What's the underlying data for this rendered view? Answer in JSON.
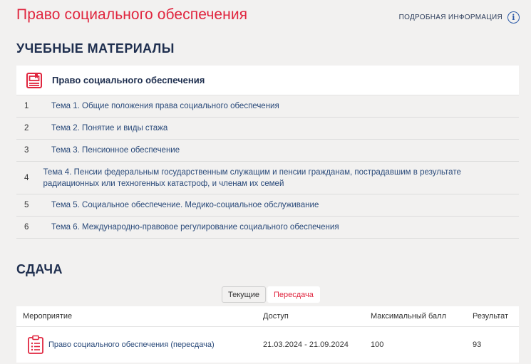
{
  "header": {
    "title": "Право социального обеспечения",
    "more_info": "ПОДРОБНАЯ ИНФОРМАЦИЯ",
    "info_glyph": "i"
  },
  "materials": {
    "section_title": "УЧЕБНЫЕ МАТЕРИАЛЫ",
    "course_name": "Право социального обеспечения",
    "topics": [
      {
        "num": "1",
        "title": "Тема 1. Общие положения права социального обеспечения"
      },
      {
        "num": "2",
        "title": "Тема 2. Понятие и виды стажа"
      },
      {
        "num": "3",
        "title": "Тема 3. Пенсионное обеспечение"
      },
      {
        "num": "4",
        "title": "Тема 4. Пенсии федеральным государственным служащим и пенсии гражданам, пострадавшим в результате радиационных или техногенных катастроф, и членам их семей"
      },
      {
        "num": "5",
        "title": "Тема 5. Социальное обеспечение. Медико-социальное обслуживание"
      },
      {
        "num": "6",
        "title": "Тема 6. Международно-правовое регулирование социального обеспечения"
      }
    ]
  },
  "exams": {
    "section_title": "СДАЧА",
    "tabs": [
      {
        "label": "Текущие",
        "active": false
      },
      {
        "label": "Пересдача",
        "active": true
      }
    ],
    "columns": [
      "Мероприятие",
      "Доступ",
      "Максимальный балл",
      "Результат"
    ],
    "rows": [
      {
        "event": "Право социального обеспечения (пересдача)",
        "access": "21.03.2024 - 21.09.2024",
        "max_score": "100",
        "result": "93"
      }
    ]
  },
  "colors": {
    "accent_red": "#e0263f",
    "navy": "#1f2f4f",
    "link_blue": "#2a4a7a",
    "info_blue": "#2c5aa8",
    "background": "#f2f1f0"
  }
}
